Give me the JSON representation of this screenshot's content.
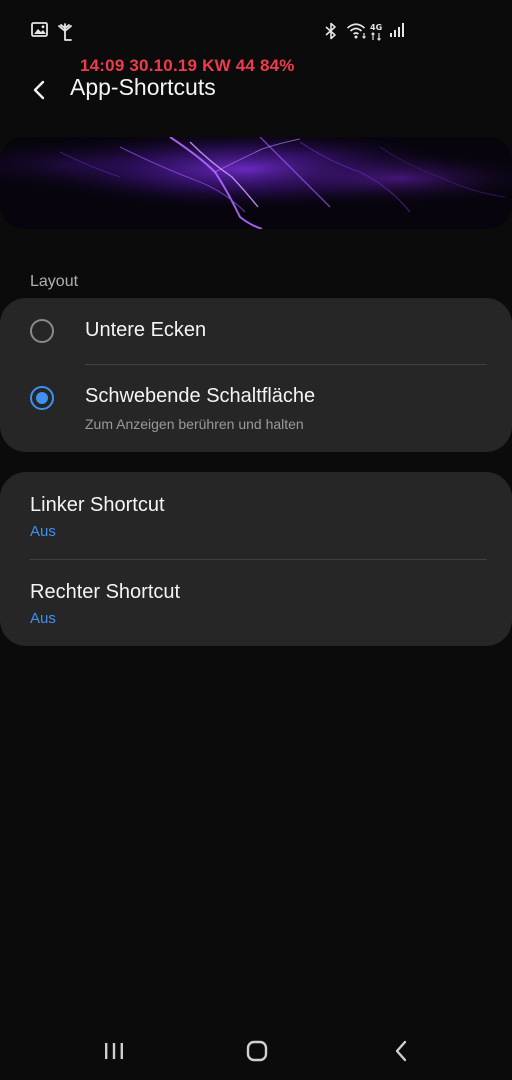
{
  "status_bar": {
    "overlay_text": "14:09 30.10.19 KW 44 84%",
    "network_label": "4G",
    "icons": [
      "image-icon",
      "antenna-icon",
      "bluetooth-icon",
      "wifi-icon",
      "mobile-data-icon",
      "signal-icon"
    ]
  },
  "header": {
    "back_icon": "chevron-left-icon",
    "title": "App-Shortcuts"
  },
  "layout_section": {
    "label": "Layout",
    "options": [
      {
        "label": "Untere Ecken",
        "subtitle": "",
        "selected": false
      },
      {
        "label": "Schwebende Schaltfläche",
        "subtitle": "Zum Anzeigen berühren und halten",
        "selected": true
      }
    ]
  },
  "shortcuts": [
    {
      "label": "Linker Shortcut",
      "value": "Aus"
    },
    {
      "label": "Rechter Shortcut",
      "value": "Aus"
    }
  ],
  "nav_bar": {
    "buttons": [
      "recents-icon",
      "home-icon",
      "back-icon"
    ]
  },
  "colors": {
    "background": "#0b0b0b",
    "card": "#262626",
    "accent": "#3e91f0",
    "overlay_text": "#ef3b4e"
  }
}
